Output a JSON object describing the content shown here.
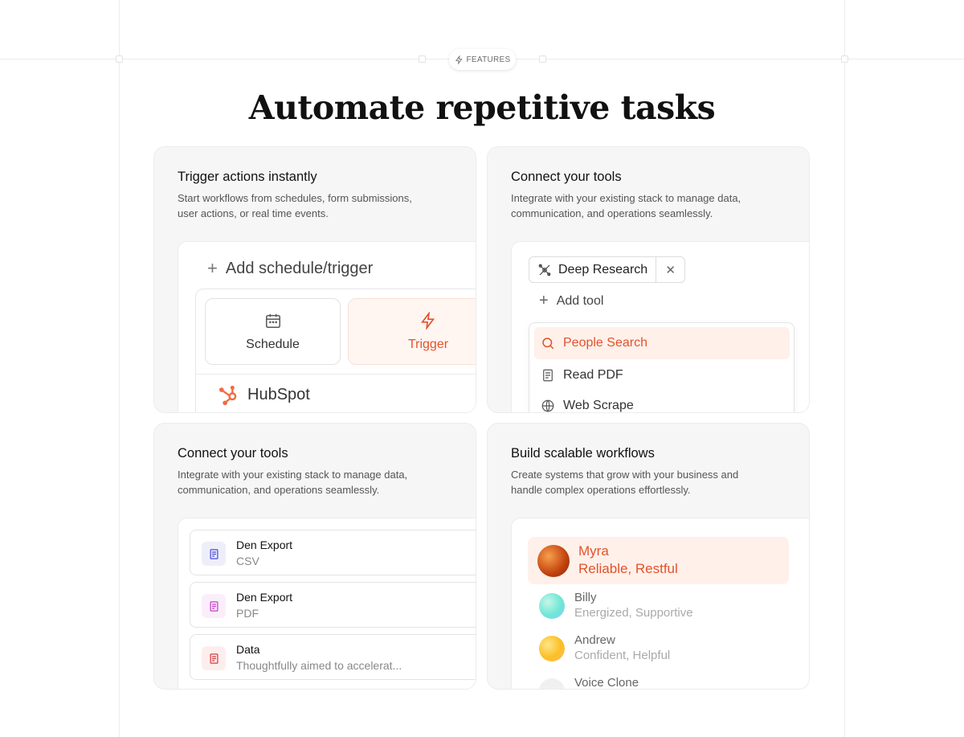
{
  "badge": {
    "label": "FEATURES"
  },
  "heading": "Automate repetitive tasks",
  "cards": {
    "trigger": {
      "title": "Trigger actions instantly",
      "description": "Start workflows from schedules, form submissions, user actions, or real time events.",
      "add_label": "Add schedule/trigger",
      "schedule_label": "Schedule",
      "trigger_label": "Trigger",
      "integration_label": "HubSpot"
    },
    "tools": {
      "title": "Connect your tools",
      "description": "Integrate with your existing stack to manage data, communication, and operations seamlessly.",
      "selected_tool": "Deep Research",
      "add_tool_label": "Add tool",
      "menu_items": [
        "People Search",
        "Read PDF",
        "Web Scrape"
      ]
    },
    "files": {
      "title": "Connect your tools",
      "description": "Integrate with your existing stack to manage data, communication, and operations seamlessly.",
      "items": [
        {
          "name": "Den Export",
          "sub": "CSV"
        },
        {
          "name": "Den Export",
          "sub": "PDF"
        },
        {
          "name": "Data",
          "sub": "Thoughtfully aimed to accelerat..."
        }
      ]
    },
    "workflows": {
      "title": "Build scalable workflows",
      "description": "Create systems that grow with your business and handle complex operations effortlessly.",
      "voices": [
        {
          "name": "Myra",
          "traits": "Reliable, Restful"
        },
        {
          "name": "Billy",
          "traits": "Energized, Supportive"
        },
        {
          "name": "Andrew",
          "traits": "Confident, Helpful"
        },
        {
          "name": "Voice Clone",
          "traits": ""
        }
      ]
    }
  },
  "colors": {
    "accent": "#e2532b",
    "accent_bg": "#fff0ea",
    "card_bg": "#f6f6f6"
  }
}
